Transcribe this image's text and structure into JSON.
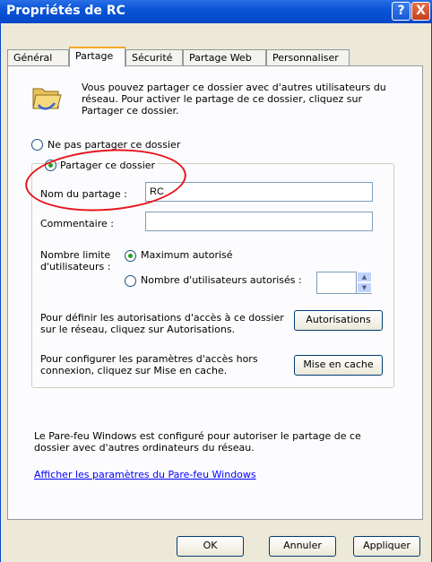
{
  "window": {
    "title": "Propriétés de RC",
    "help_glyph": "?",
    "close_glyph": "X"
  },
  "tabs": [
    {
      "label": "Général"
    },
    {
      "label": "Partage"
    },
    {
      "label": "Sécurité"
    },
    {
      "label": "Partage Web"
    },
    {
      "label": "Personnaliser"
    }
  ],
  "sharing": {
    "intro_text": "Vous pouvez partager ce dossier avec d'autres utilisateurs du réseau. Pour activer le partage de ce dossier, cliquez sur Partager ce dossier.",
    "no_share_label": "Ne pas partager ce dossier",
    "share_label": "Partager ce dossier",
    "share_name_label": "Nom du partage :",
    "share_name_value": "RC",
    "comment_label": "Commentaire :",
    "comment_value": "",
    "user_limit_label_line1": "Nombre limite",
    "user_limit_label_line2": "d'utilisateurs :",
    "max_allowed_label": "Maximum autorisé",
    "allowed_users_label": "Nombre d'utilisateurs autorisés :",
    "allowed_users_value": "",
    "permissions_text": "Pour définir les autorisations d'accès à ce dossier sur le réseau, cliquez sur Autorisations.",
    "permissions_button": "Autorisations",
    "cache_text": "Pour configurer les paramètres d'accès hors connexion, cliquez sur Mise en cache.",
    "cache_button": "Mise en cache",
    "firewall_text": "Le Pare-feu Windows est configuré pour autoriser le partage de ce dossier avec d'autres ordinateurs du réseau.",
    "firewall_link": "Afficher les paramètres du Pare-feu Windows"
  },
  "footer": {
    "ok": "OK",
    "cancel": "Annuler",
    "apply": "Appliquer"
  },
  "colors": {
    "title_bar": "#0a54d8",
    "dialog_bg": "#ece9d8",
    "active_tab_accent": "#f5a623",
    "annotation_circle": "#e8141e",
    "link": "#0000ff"
  },
  "icons": [
    "folder-share-icon",
    "help-icon",
    "close-icon",
    "spin-up-icon",
    "spin-down-icon"
  ]
}
